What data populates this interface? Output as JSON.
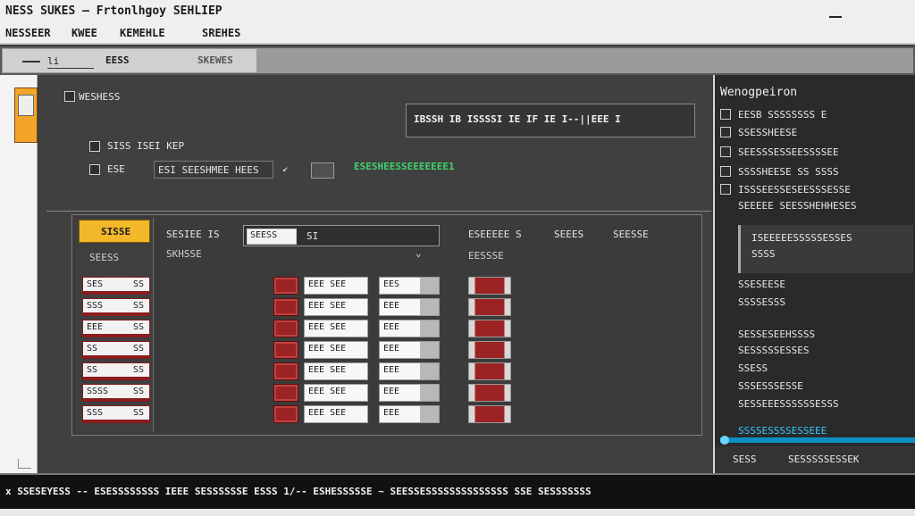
{
  "window": {
    "title": "NESS SUKES — Frtonlhgoy SEHLIEP"
  },
  "menu": {
    "items": [
      "NESSEER",
      "KWEE",
      "KEMEHLE",
      "SREHES"
    ]
  },
  "toolbar": {
    "field_value": "li",
    "tab1": "EESS",
    "tab2": "SKEWES"
  },
  "main": {
    "section_title": "WESHESS",
    "search_text": "IBSSH  IB    ISSSSI   IE   IF   IE  I--||EEE I",
    "row1_label": "SISS ISEI KEP",
    "row2_prefix": "ESE",
    "input_value": "ESI SEESHMEE HEES",
    "status_text": "ESESHEESSEEEEEEE1",
    "list": {
      "header": "SISSE",
      "sub": "SEESS",
      "rows": [
        {
          "a": "SES",
          "b": "SS"
        },
        {
          "a": "SSS",
          "b": "SS"
        },
        {
          "a": "EEE",
          "b": "SS"
        },
        {
          "a": "SS",
          "b": "SS"
        },
        {
          "a": "SS",
          "b": "SS"
        },
        {
          "a": "SSSS",
          "b": "SS"
        },
        {
          "a": "SSS",
          "b": "SS"
        }
      ]
    },
    "combo": {
      "label": "SESIEE IS",
      "value": "SEESS",
      "suffix": "SI",
      "below": "SKHSSE"
    },
    "mid_labels": {
      "a": "ESEEEEE S",
      "b": "SEEES",
      "c": "SEESSE",
      "d": "EESSSE"
    },
    "grid": {
      "white": [
        "EEE SEE",
        "EEE SEE",
        "EEE SEE",
        "EEE SEE",
        "EEE SEE",
        "EEE SEE",
        "EEE SEE"
      ],
      "half": [
        "EES",
        "EEE",
        "EEE",
        "EEE",
        "EEE",
        "EEE",
        "EEE"
      ]
    }
  },
  "right": {
    "title": "Wenogpeiron",
    "items": [
      "EESB  SSSSSSSS E",
      "SSESSHEESE",
      "SEESSSESSEESSSSEE",
      "SSSSHEESE SS SSSS",
      "ISSSEESSESEESSSESSE",
      "SEEEEE  SEESSHEHHESES"
    ],
    "box_line1": "ISEEEEESSSSSESSES",
    "box_line2": "SSSS",
    "items2": [
      "SSESEESE",
      "SSSSESSS",
      "SESSESEEHSSSS",
      "SESSSSSESSES",
      "SSESS",
      "SSSESSSESSE",
      "SESSEEESSSSSSESSS"
    ],
    "progress_label": "SSSSESSSSESSEEE",
    "progress": 1.0,
    "footer_a": "SESS",
    "footer_b": "SESSSSSESSEK"
  },
  "status": {
    "text": "x  SSESEYESS -- ESESSSSSSSS IEEE  SESSSSSSE  ESSS 1/-- ESHESSSSSE ~  SEESSESSSSSSSSSSSSSS  SSE  SESSSSSSS"
  }
}
